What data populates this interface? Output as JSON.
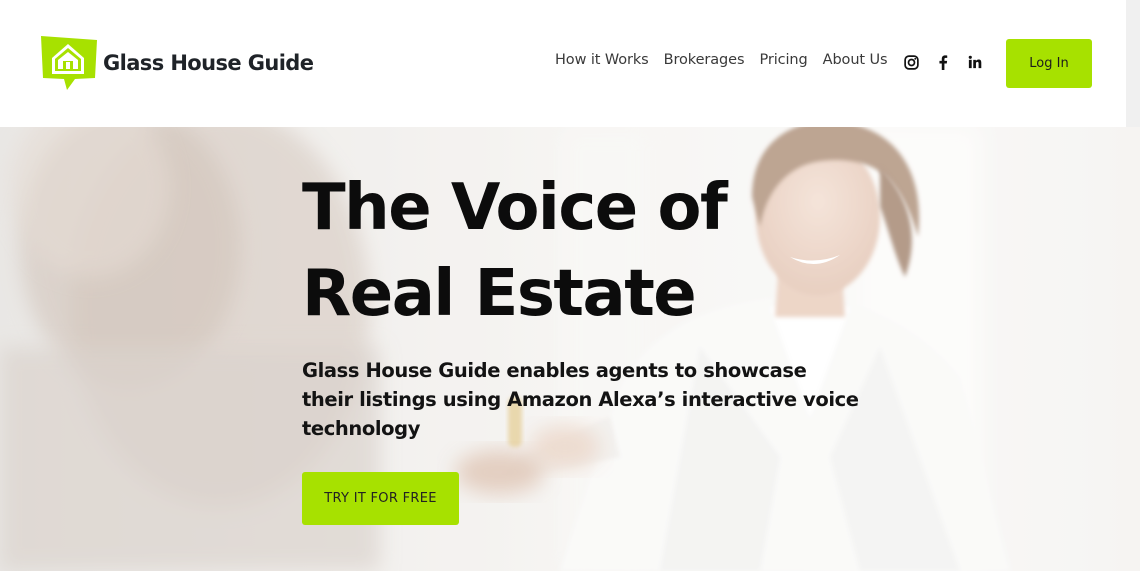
{
  "brand": {
    "name": "Glass House Guide",
    "accent_color": "#a7e100"
  },
  "nav": {
    "items": [
      {
        "label": "How it Works"
      },
      {
        "label": "Brokerages"
      },
      {
        "label": "Pricing"
      },
      {
        "label": "About Us"
      }
    ],
    "social_icons": [
      "instagram-icon",
      "facebook-icon",
      "linkedin-icon"
    ],
    "login_label": "Log In"
  },
  "hero": {
    "title_line1": "The Voice of",
    "title_line2": "Real Estate",
    "subtitle": "Glass House Guide enables agents to showcase their listings using Amazon Alexa’s interactive voice technology",
    "cta_label": "TRY IT FOR FREE",
    "background_image": "smiling-agent-handing-keys-photo"
  }
}
